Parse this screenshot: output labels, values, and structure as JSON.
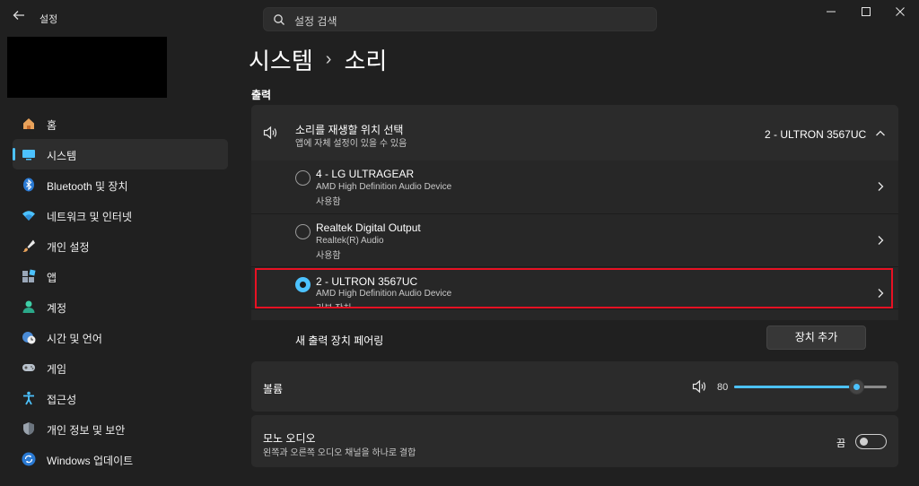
{
  "app": {
    "title": "설정"
  },
  "search": {
    "placeholder": "설정 검색"
  },
  "sidebar": {
    "items": [
      {
        "label": "홈",
        "icon": "home-icon"
      },
      {
        "label": "시스템",
        "icon": "system-icon",
        "selected": true
      },
      {
        "label": "Bluetooth 및 장치",
        "icon": "bluetooth-icon"
      },
      {
        "label": "네트워크 및 인터넷",
        "icon": "network-icon"
      },
      {
        "label": "개인 설정",
        "icon": "personalization-icon"
      },
      {
        "label": "앱",
        "icon": "apps-icon"
      },
      {
        "label": "계정",
        "icon": "accounts-icon"
      },
      {
        "label": "시간 및 언어",
        "icon": "time-language-icon"
      },
      {
        "label": "게임",
        "icon": "gaming-icon"
      },
      {
        "label": "접근성",
        "icon": "accessibility-icon"
      },
      {
        "label": "개인 정보 및 보안",
        "icon": "privacy-shield-icon"
      },
      {
        "label": "Windows 업데이트",
        "icon": "windows-update-icon"
      }
    ]
  },
  "breadcrumb": {
    "parent": "시스템",
    "separator": "›",
    "current": "소리"
  },
  "output": {
    "section_label": "출력",
    "selector": {
      "title": "소리를 재생할 위치 선택",
      "subtitle": "앱에 자체 설정이 있을 수 있음",
      "value": "2 - ULTRON 3567UC"
    },
    "devices": [
      {
        "name": "4 - LG ULTRAGEAR",
        "driver": "AMD High Definition Audio Device",
        "status": "사용함",
        "selected": false
      },
      {
        "name": "Realtek Digital Output",
        "driver": "Realtek(R) Audio",
        "status": "사용함",
        "selected": false
      },
      {
        "name": "2 - ULTRON 3567UC",
        "driver": "AMD High Definition Audio Device",
        "status": "기본 장치",
        "selected": true
      }
    ],
    "pair": {
      "label": "새 출력 장치 페어링",
      "button": "장치 추가"
    }
  },
  "volume": {
    "label": "볼륨",
    "value": "80",
    "level": 0.8
  },
  "mono": {
    "title": "모노 오디오",
    "subtitle": "왼쪽과 오른쪽 오디오 채널을 하나로 결합",
    "state": "끔",
    "on": false
  },
  "colors": {
    "accent": "#4cc2ff",
    "background": "#202020",
    "card": "#2b2b2b",
    "highlight": "#e81123"
  }
}
